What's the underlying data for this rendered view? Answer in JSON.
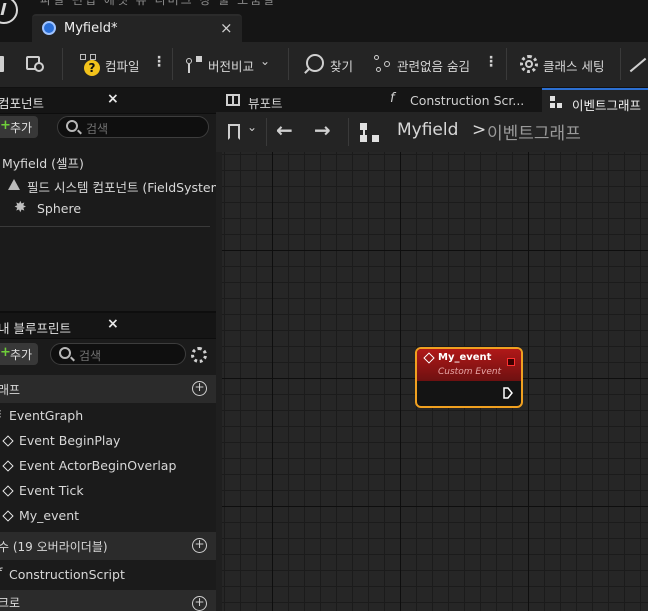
{
  "window": {
    "doc_tab_title": "Myfield*",
    "doc_tab_close": "×"
  },
  "toolbar": {
    "compile_label": "컴파일",
    "diff_label": "버전비교",
    "find_label": "찾기",
    "hide_unrelated_label": "관련없음 숨김",
    "class_settings_label": "클래스 세팅",
    "more": "⋮"
  },
  "components_panel": {
    "title": "컴포넌트",
    "close": "×",
    "add_label": "추가",
    "add_plus": "+",
    "search_placeholder": "검색",
    "tree": [
      {
        "label": "Myfield (셀프)"
      },
      {
        "label": "필드 시스템 컴포넌트 (FieldSystem"
      },
      {
        "label": "Sphere"
      }
    ]
  },
  "blueprint_panel": {
    "title": "내 블루프린트",
    "close": "×",
    "add_label": "추가",
    "add_plus": "+",
    "search_placeholder": "검색",
    "graphs_section": "래프",
    "graph_items": [
      "EventGraph",
      "Event BeginPlay",
      "Event ActorBeginOverlap",
      "Event Tick",
      "My_event"
    ],
    "functions_section": "수 (19 오버라이더블)",
    "function_items": [
      "ConstructionScript"
    ],
    "macros_section": "크로",
    "section_plus": "+"
  },
  "view_tabs": {
    "viewport": "뷰포트",
    "construction": "Construction Scr...",
    "event_graph": "이벤트그래프"
  },
  "graph_bar": {
    "breadcrumb_root": "Myfield",
    "breadcrumb_sep": ">",
    "breadcrumb_current": "이벤트그래프"
  },
  "node": {
    "title": "My_event",
    "subtitle": "Custom Event"
  },
  "colors": {
    "accent_blue": "#2c6fd1",
    "node_header": "#b01818",
    "node_selected_border": "#f0a020",
    "add_green": "#6fcf3a"
  }
}
